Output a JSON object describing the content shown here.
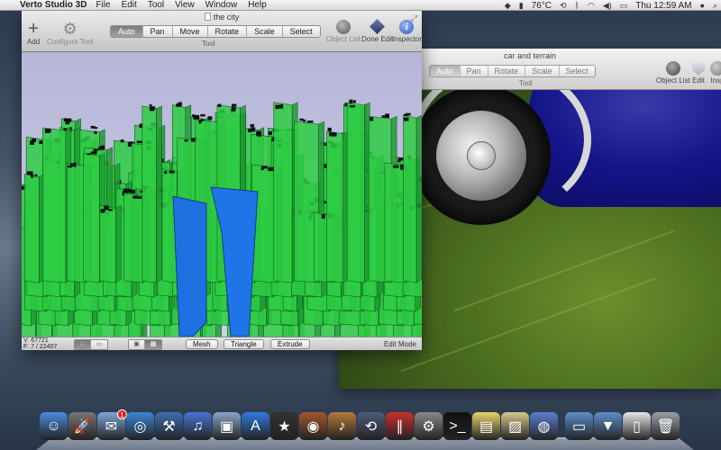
{
  "menubar": {
    "app_name": "Verto Studio 3D",
    "menus": [
      "File",
      "Edit",
      "Tool",
      "View",
      "Window",
      "Help"
    ],
    "status": {
      "temp": "76°C",
      "clock": "Thu 12:59 AM"
    }
  },
  "city_window": {
    "title": "the city",
    "add_label": "Add",
    "configure_label": "Configure Tool",
    "tool_segments": [
      "Auto",
      "Pan",
      "Move",
      "Rotate",
      "Scale",
      "Select"
    ],
    "active_tool": "Auto",
    "tool_caption": "Tool",
    "object_list_label": "Object List",
    "done_edit_label": "Done Edit",
    "inspector_label": "Inspector",
    "stats_line1": "V: 67721",
    "stats_line2": "F: 7 / 22407",
    "mesh_label": "Mesh",
    "triangle_label": "Triangle",
    "extrude_label": "Extrude",
    "mode_label": "Edit Mode"
  },
  "car_window": {
    "title": "car and terrain",
    "tool_segments": [
      "Auto",
      "Pan",
      "Rotate",
      "Scale",
      "Select"
    ],
    "active_tool": "Auto",
    "tool_caption": "Tool",
    "object_list_label": "Object List",
    "edit_label": "Edit",
    "inspector_label": "Insp"
  },
  "colors": {
    "building_green": "#2ecc44",
    "building_blue": "#1e6fe0",
    "grid_bg": "#c4c4e0"
  },
  "dock": {
    "items": [
      {
        "icon": "finder-icon",
        "color": "#4a8be0"
      },
      {
        "icon": "launchpad-icon",
        "color": "#777"
      },
      {
        "icon": "mail-icon",
        "color": "#7fa6d8",
        "badge": "1"
      },
      {
        "icon": "safari-icon",
        "color": "#3c86d8"
      },
      {
        "icon": "xcode-icon",
        "color": "#3d6fb3"
      },
      {
        "icon": "itunes-icon",
        "color": "#4776d6"
      },
      {
        "icon": "iphoto-icon",
        "color": "#8aa4c6"
      },
      {
        "icon": "app-store-icon",
        "color": "#2f7ae0"
      },
      {
        "icon": "imovie-icon",
        "color": "#333"
      },
      {
        "icon": "photo-booth-icon",
        "color": "#a4562c"
      },
      {
        "icon": "garageband-icon",
        "color": "#b57a36"
      },
      {
        "icon": "time-machine-icon",
        "color": "#4d5b7a"
      },
      {
        "icon": "parallels-icon",
        "color": "#c9302c"
      },
      {
        "icon": "system-preferences-icon",
        "color": "#888"
      },
      {
        "icon": "terminal-icon",
        "color": "#111"
      },
      {
        "icon": "stickies-icon",
        "color": "#e8d46a"
      },
      {
        "icon": "preview-icon",
        "color": "#d8c88a"
      },
      {
        "icon": "blender-icon",
        "color": "#5b7fd1"
      },
      {
        "icon": "applications-folder-icon",
        "color": "#5d8fc9"
      },
      {
        "icon": "downloads-folder-icon",
        "color": "#5d8fc9"
      },
      {
        "icon": "document-icon",
        "color": "#e6e6e6"
      },
      {
        "icon": "trash-icon",
        "color": "#9aa0a8"
      }
    ]
  }
}
